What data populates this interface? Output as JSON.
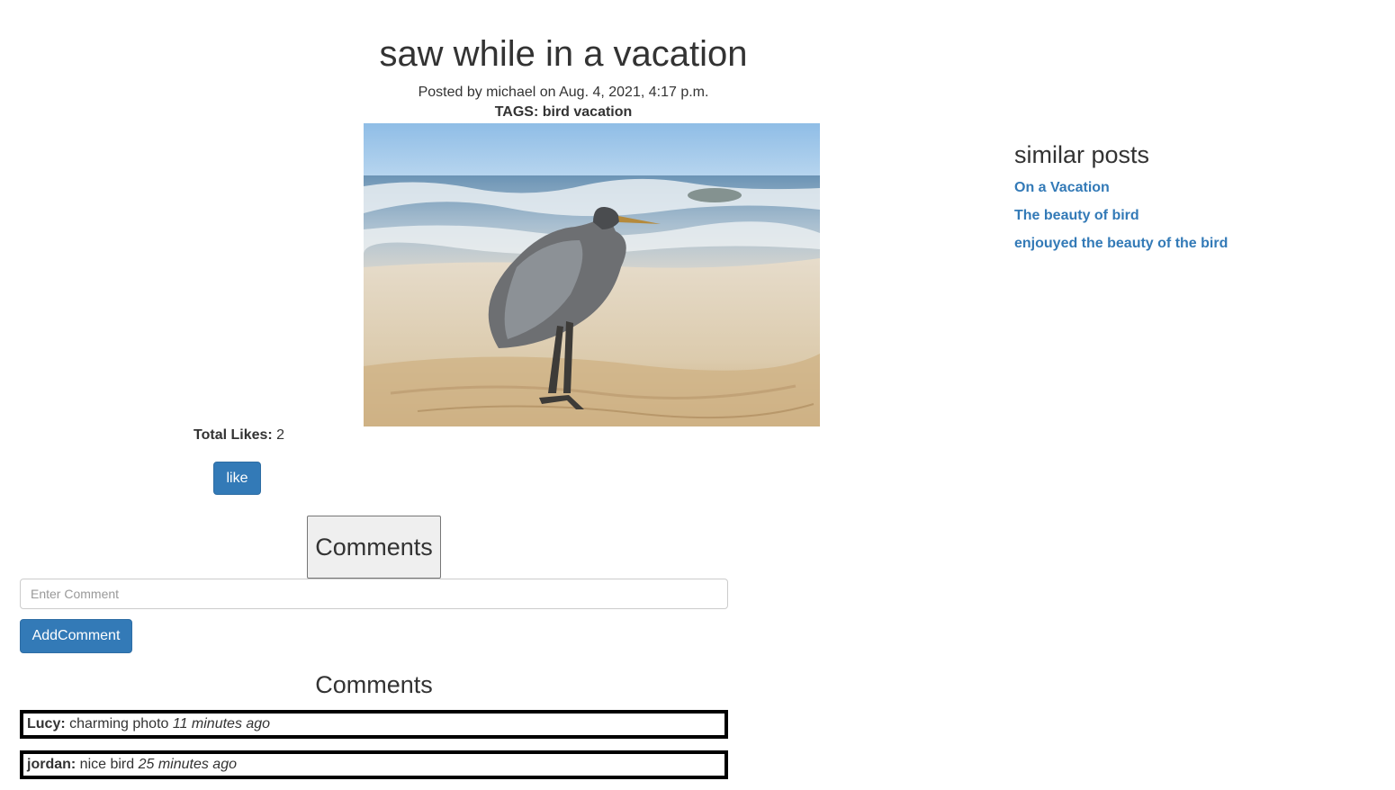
{
  "post": {
    "title": "saw while in a vacation",
    "meta": "Posted by michael on Aug. 4, 2021, 4:17 p.m.",
    "tags_label": "TAGS: bird vacation"
  },
  "likes": {
    "label": "Total Likes:",
    "count": "2",
    "button_label": "like"
  },
  "comment_form": {
    "toggle_label": "Comments",
    "input_placeholder": "Enter Comment",
    "input_value": "",
    "submit_label": "AddComment"
  },
  "comments": {
    "heading": "Comments",
    "items": [
      {
        "author": "Lucy:",
        "text": " charming photo ",
        "time": "11 minutes ago"
      },
      {
        "author": "jordan:",
        "text": " nice bird ",
        "time": "25 minutes ago"
      }
    ]
  },
  "similar_posts": {
    "heading": "similar posts",
    "links": [
      "On a Vacation",
      "The beauty of bird",
      "enjouyed the beauty of the bird"
    ]
  },
  "colors": {
    "link": "#337ab7",
    "button": "#337ab7",
    "text": "#333333"
  },
  "icons": {
    "post_image": "heron-on-beach-photo"
  }
}
